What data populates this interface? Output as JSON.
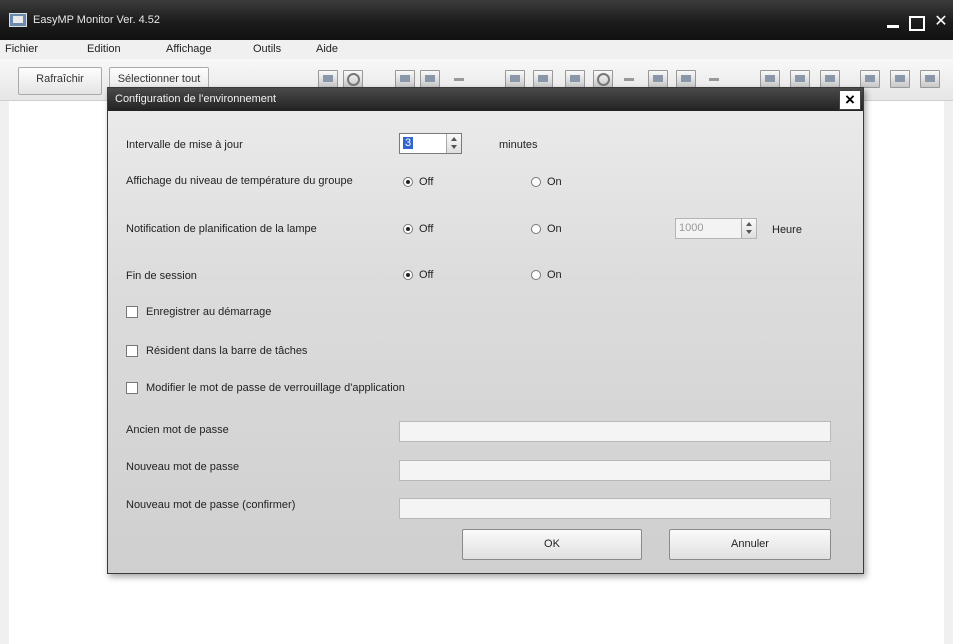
{
  "window": {
    "title": "EasyMP Monitor Ver. 4.52",
    "controls": [
      "minimize",
      "maximize",
      "close"
    ]
  },
  "menu": {
    "items": [
      "Fichier",
      "Edition",
      "Affichage",
      "Outils",
      "Aide"
    ]
  },
  "toolbar": {
    "refresh_label": "Rafraîchir",
    "select_all_label": "Sélectionner tout"
  },
  "dialog": {
    "title": "Configuration de l'environnement",
    "close_label": "×",
    "update_interval": {
      "label": "Intervalle de mise à jour",
      "value": "3",
      "unit": "minutes"
    },
    "temperature_display": {
      "label": "Affichage du niveau de température du groupe",
      "off_label": "Off",
      "on_label": "On",
      "selected": "Off"
    },
    "lamp_notification": {
      "label": "Notification de planification de la lampe",
      "off_label": "Off",
      "on_label": "On",
      "selected": "Off",
      "hours_value": "1000",
      "hours_unit": "Heure"
    },
    "session_end": {
      "label": "Fin de session",
      "off_label": "Off",
      "on_label": "On",
      "selected": "Off"
    },
    "checkboxes": {
      "register_startup": "Enregistrer au démarrage",
      "taskbar_resident": "Résident dans la barre de tâches",
      "change_lock_password": "Modifier le mot de passe de verrouillage d'application"
    },
    "passwords": {
      "old_label": "Ancien mot de passe",
      "new_label": "Nouveau mot de passe",
      "confirm_label": "Nouveau mot de passe (confirmer)",
      "old_value": "",
      "new_value": "",
      "confirm_value": ""
    },
    "buttons": {
      "ok": "OK",
      "cancel": "Annuler"
    }
  },
  "colors": {
    "titlebar": "#1c1c1c",
    "dialog_bg": "#d8d8d8",
    "selection": "#3366cc"
  }
}
